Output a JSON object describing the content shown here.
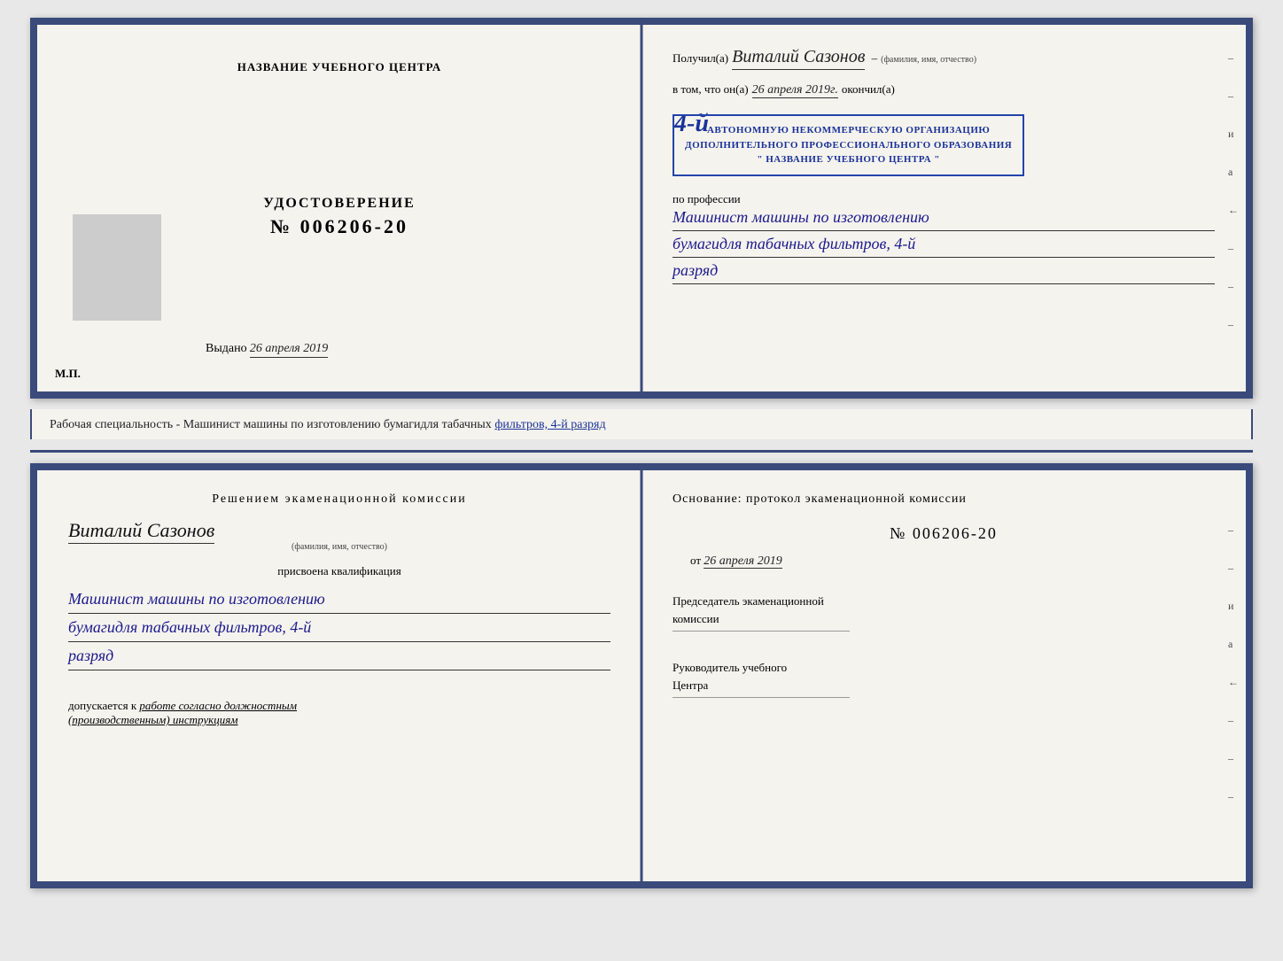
{
  "top_doc": {
    "left": {
      "title": "НАЗВАНИЕ УЧЕБНОГО ЦЕНТРА",
      "cert_label": "УДОСТОВЕРЕНИЕ",
      "cert_number": "№ 006206-20",
      "issued_text": "Выдано",
      "issued_date": "26 апреля 2019",
      "mp_label": "М.П."
    },
    "right": {
      "received_prefix": "Получил(а)",
      "recipient_name": "Виталий Сазонов",
      "recipient_sub": "(фамилия, имя, отчество)",
      "tom_prefix": "в том, что он(а)",
      "tom_date": "26 апреля 2019г.",
      "tom_suffix": "окончил(а)",
      "stamp_line1": "4-й",
      "stamp_line2": "АВТОНОМНУЮ НЕКОММЕРЧЕСКУЮ ОРГАНИЗАЦИЮ",
      "stamp_line3": "ДОПОЛНИТЕЛЬНОГО ПРОФЕССИОНАЛЬНОГО ОБРАЗОВАНИЯ",
      "stamp_line4": "\" НАЗВАНИЕ УЧЕБНОГО ЦЕНТРА \"",
      "profession_label": "по профессии",
      "profession_line1": "Машинист машины по изготовлению",
      "profession_line2": "бумагидля табачных фильтров, 4-й",
      "profession_line3": "разряд",
      "right_dashes": [
        "–",
        "–",
        "и",
        "а",
        "←",
        "–",
        "–",
        "–"
      ]
    }
  },
  "middle": {
    "specialty_text": "Рабочая специальность - Машинист машины по изготовлению бумагидля табачных",
    "specialty_underlined": "фильтров, 4-й разряд"
  },
  "bottom_doc": {
    "left": {
      "decision_title": "Решением  экаменационной  комиссии",
      "person_name": "Виталий Сазонов",
      "person_sub": "(фамилия, имя, отчество)",
      "assigned_label": "присвоена квалификация",
      "qual_line1": "Машинист машины по изготовлению",
      "qual_line2": "бумагидля табачных фильтров, 4-й",
      "qual_line3": "разряд",
      "allowed_prefix": "допускается к",
      "allowed_text": "работе согласно должностным",
      "allowed_text2": "(производственным) инструкциям"
    },
    "right": {
      "basis_title": "Основание:  протокол  экаменационной  комиссии",
      "number": "№  006206-20",
      "date_prefix": "от",
      "date_value": "26 апреля 2019",
      "chair_label": "Председатель экаменационной",
      "chair_label2": "комиссии",
      "director_label": "Руководитель учебного",
      "director_label2": "Центра",
      "right_dashes": [
        "–",
        "–",
        "и",
        "а",
        "←",
        "–",
        "–",
        "–"
      ]
    }
  }
}
